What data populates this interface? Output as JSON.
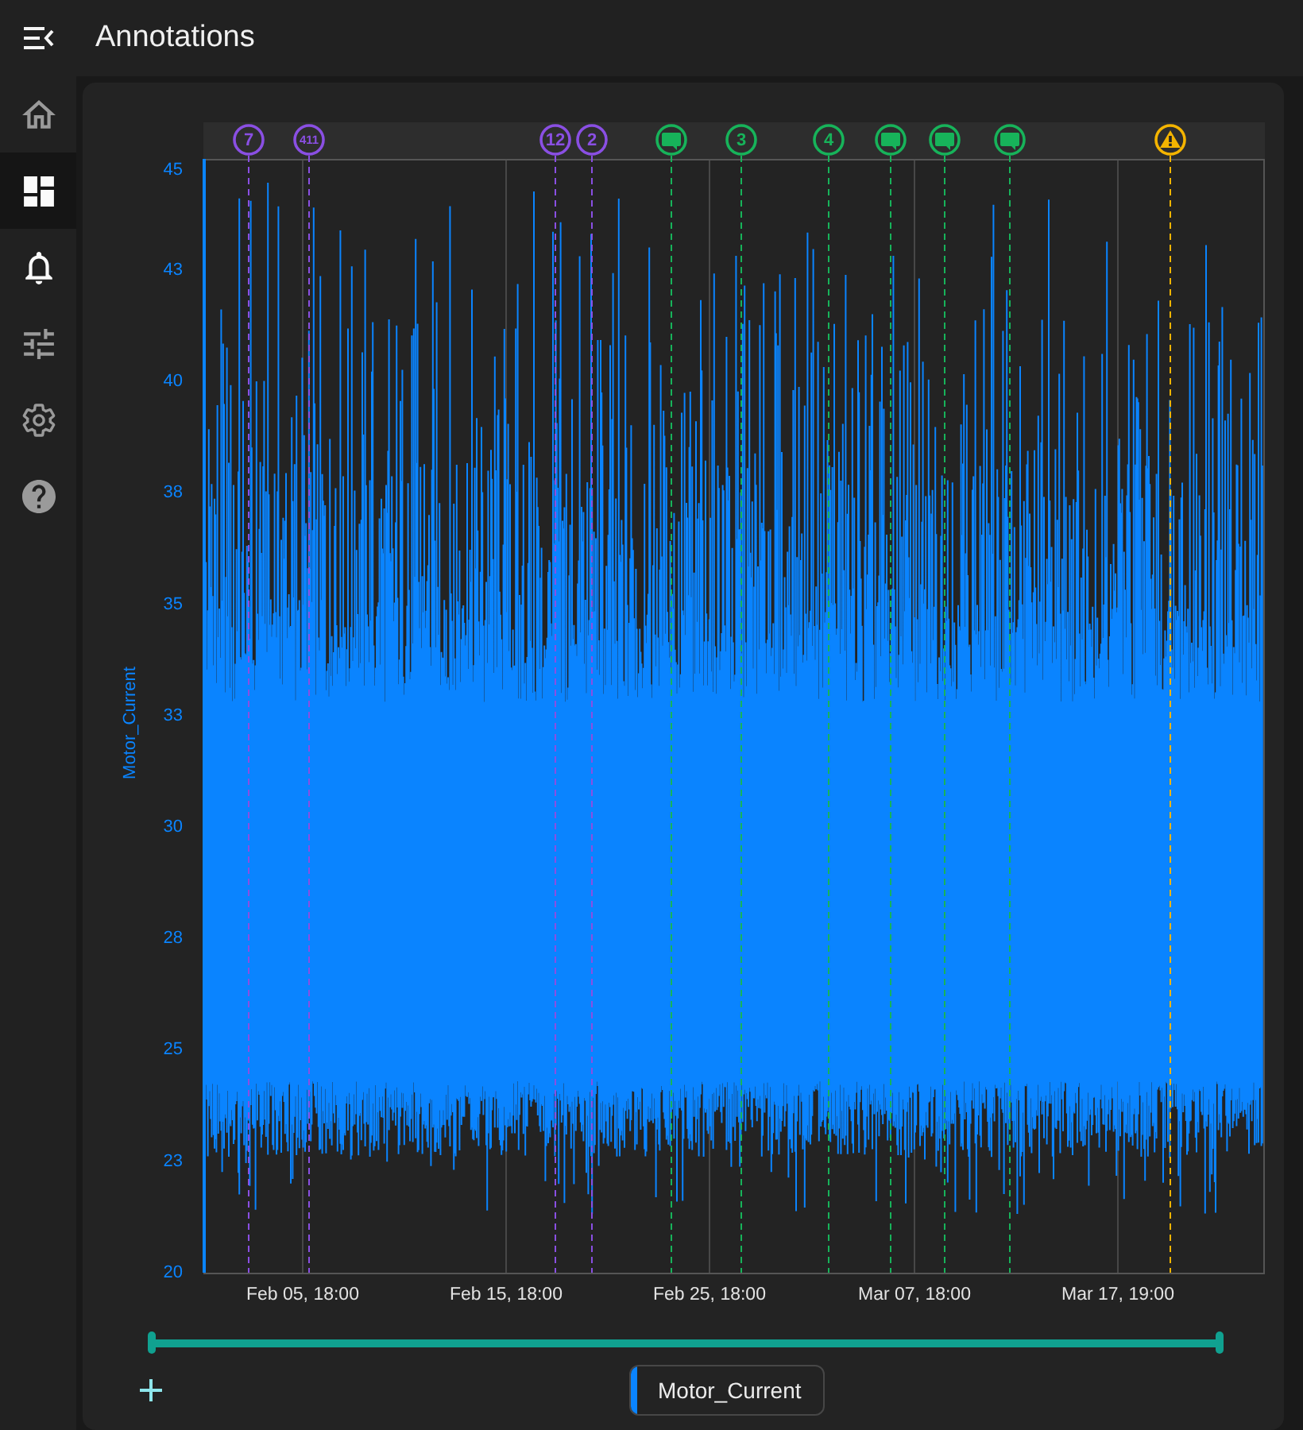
{
  "app_bar": {
    "title": "Annotations"
  },
  "sidebar": {
    "items": [
      {
        "kind": "home",
        "selected": false,
        "highlighted": false
      },
      {
        "kind": "dashboard",
        "selected": true,
        "highlighted": true
      },
      {
        "kind": "bell",
        "selected": false,
        "highlighted": true
      },
      {
        "kind": "tune",
        "selected": false,
        "highlighted": false
      },
      {
        "kind": "settings",
        "selected": false,
        "highlighted": false
      },
      {
        "kind": "help",
        "selected": false,
        "highlighted": false
      }
    ]
  },
  "chart": {
    "y_axis_label": "Motor_Current",
    "y_ticks": [
      "45",
      "43",
      "40",
      "38",
      "35",
      "33",
      "30",
      "28",
      "25",
      "23",
      "20"
    ],
    "x_ticks": [
      "Feb 05, 18:00",
      "Feb 15, 18:00",
      "Feb 25, 18:00",
      "Mar 07, 18:00",
      "Mar 17, 19:00"
    ],
    "annotations": [
      {
        "kind": "count",
        "label": "7",
        "color": "#8a4fe3"
      },
      {
        "kind": "count",
        "label": "411",
        "color": "#8a4fe3"
      },
      {
        "kind": "count",
        "label": "12",
        "color": "#8a4fe3"
      },
      {
        "kind": "count",
        "label": "2",
        "color": "#8a4fe3"
      },
      {
        "kind": "comment",
        "color": "#17b35a"
      },
      {
        "kind": "count",
        "label": "3",
        "color": "#17b35a"
      },
      {
        "kind": "count",
        "label": "4",
        "color": "#17b35a"
      },
      {
        "kind": "comment",
        "color": "#17b35a"
      },
      {
        "kind": "comment",
        "color": "#17b35a"
      },
      {
        "kind": "comment",
        "color": "#17b35a"
      },
      {
        "kind": "warning",
        "color": "#f4b400"
      }
    ]
  },
  "legend": {
    "series": [
      {
        "name": "Motor_Current",
        "color": "#0a84ff"
      }
    ]
  }
}
